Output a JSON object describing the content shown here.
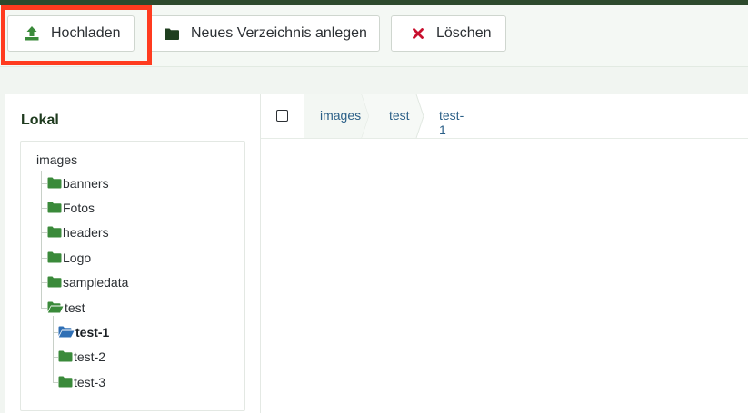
{
  "toolbar": {
    "upload_label": "Hochladen",
    "newdir_label": "Neues Verzeichnis anlegen",
    "delete_label": "Löschen"
  },
  "sidebar": {
    "title": "Lokal",
    "tree": {
      "root": "images",
      "items": [
        {
          "label": "banners",
          "icon": "folder-icon",
          "level": 1
        },
        {
          "label": "Fotos",
          "icon": "folder-icon",
          "level": 1
        },
        {
          "label": "headers",
          "icon": "folder-icon",
          "level": 1
        },
        {
          "label": "Logo",
          "icon": "folder-icon",
          "level": 1
        },
        {
          "label": "sampledata",
          "icon": "folder-icon",
          "level": 1
        },
        {
          "label": "test",
          "icon": "folder-open-icon",
          "level": 1
        },
        {
          "label": "test-1",
          "icon": "folder-open-icon",
          "level": 2,
          "active": true
        },
        {
          "label": "test-2",
          "icon": "folder-icon",
          "level": 2
        },
        {
          "label": "test-3",
          "icon": "folder-icon",
          "level": 2
        }
      ]
    }
  },
  "breadcrumb": {
    "items": [
      "images",
      "test",
      "test-1"
    ]
  },
  "colors": {
    "accent_green": "#3a8a3a",
    "dark_green": "#2d4a2d",
    "link_blue": "#2a5f87",
    "active_folder_blue": "#2f6fb5",
    "highlight_red": "#ff3b1f",
    "delete_red": "#c8102e"
  }
}
